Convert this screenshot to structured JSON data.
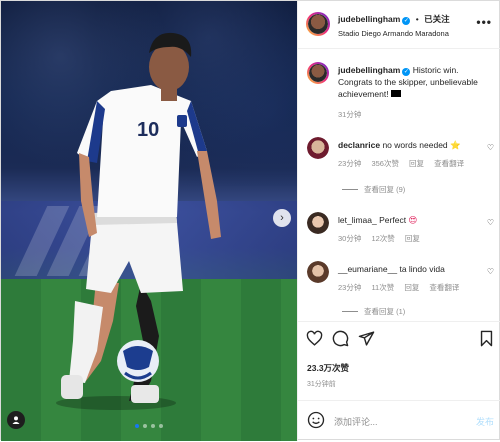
{
  "post": {
    "username": "judebellingham",
    "follow_label": "已关注",
    "separator": "•",
    "location": "Stadio Diego Armando Maradona",
    "more_label": "•••",
    "next_label": "›",
    "carousel_count": 4,
    "carousel_active": 1
  },
  "caption": {
    "username": "judebellingham",
    "text": "Historic win. Congrats to the skipper, unbelievable achievement!",
    "time": "31分钟"
  },
  "comments": [
    {
      "username": "declanrice",
      "text": "no words needed",
      "emoji": "⭐",
      "time": "23分钟",
      "likes": "356次赞",
      "reply_label": "回复",
      "translate_label": "查看翻译",
      "view_replies": "查看回复 (9)"
    },
    {
      "username": "let_limaa_",
      "text": "Perfect",
      "emoji": "😍",
      "time": "30分钟",
      "likes": "12次赞",
      "reply_label": "回复",
      "translate_label": "",
      "view_replies": ""
    },
    {
      "username": "__eumariane__",
      "text": "ta lindo vida",
      "emoji": "",
      "time": "23分钟",
      "likes": "11次赞",
      "reply_label": "回复",
      "translate_label": "查看翻译",
      "view_replies": "查看回复 (1)"
    }
  ],
  "actions": {
    "likes": "23.3万次赞",
    "time_ago": "31分钟前",
    "icons": [
      "heart-icon",
      "comment-icon",
      "share-icon",
      "bookmark-icon"
    ]
  },
  "add_comment": {
    "placeholder": "添加评论...",
    "post_label": "发布"
  },
  "colors": {
    "verified": "#0095f6",
    "post_disabled": "#b2dffc",
    "muted": "#8e8e8e",
    "carousel_active": "#1877f2"
  }
}
